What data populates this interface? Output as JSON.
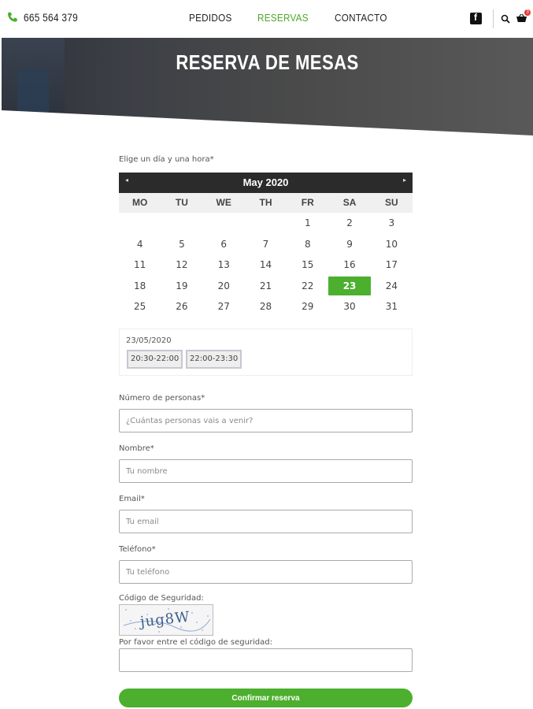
{
  "header": {
    "phone": "665 564 379",
    "nav": [
      "PEDIDOS",
      "RESERVAS",
      "CONTACTO"
    ],
    "active_nav": "RESERVAS",
    "cart_count": "3"
  },
  "hero": {
    "title": "RESERVA DE MESAS"
  },
  "form": {
    "date_label": "Elige un día y una hora*",
    "calendar": {
      "month_title": "May 2020",
      "prev": "◂",
      "next": "▸",
      "weekdays": [
        "MO",
        "TU",
        "WE",
        "TH",
        "FR",
        "SA",
        "SU"
      ],
      "days": [
        "",
        "",
        "",
        "",
        "1",
        "2",
        "3",
        "4",
        "5",
        "6",
        "7",
        "8",
        "9",
        "10",
        "11",
        "12",
        "13",
        "14",
        "15",
        "16",
        "17",
        "18",
        "19",
        "20",
        "21",
        "22",
        "23",
        "24",
        "25",
        "26",
        "27",
        "28",
        "29",
        "30",
        "31"
      ],
      "selected": "23"
    },
    "slots": {
      "date": "23/05/2020",
      "times": [
        "20:30-22:00",
        "22:00-23:30"
      ]
    },
    "people_label": "Número de personas*",
    "people_placeholder": "¿Cuántas personas vais a venir?",
    "name_label": "Nombre*",
    "name_placeholder": "Tu nombre",
    "email_label": "Email*",
    "email_placeholder": "Tu email",
    "phone_label": "Teléfono*",
    "phone_placeholder": "Tu teléfono",
    "captcha_label": "Código de Seguridad:",
    "captcha_text": "jug8W",
    "captcha_prompt": "Por favor entre el código de seguridad:",
    "submit": "Confirmar reserva"
  },
  "colors": {
    "accent": "#4caf2e",
    "dark_bar": "#2b2b2b"
  }
}
